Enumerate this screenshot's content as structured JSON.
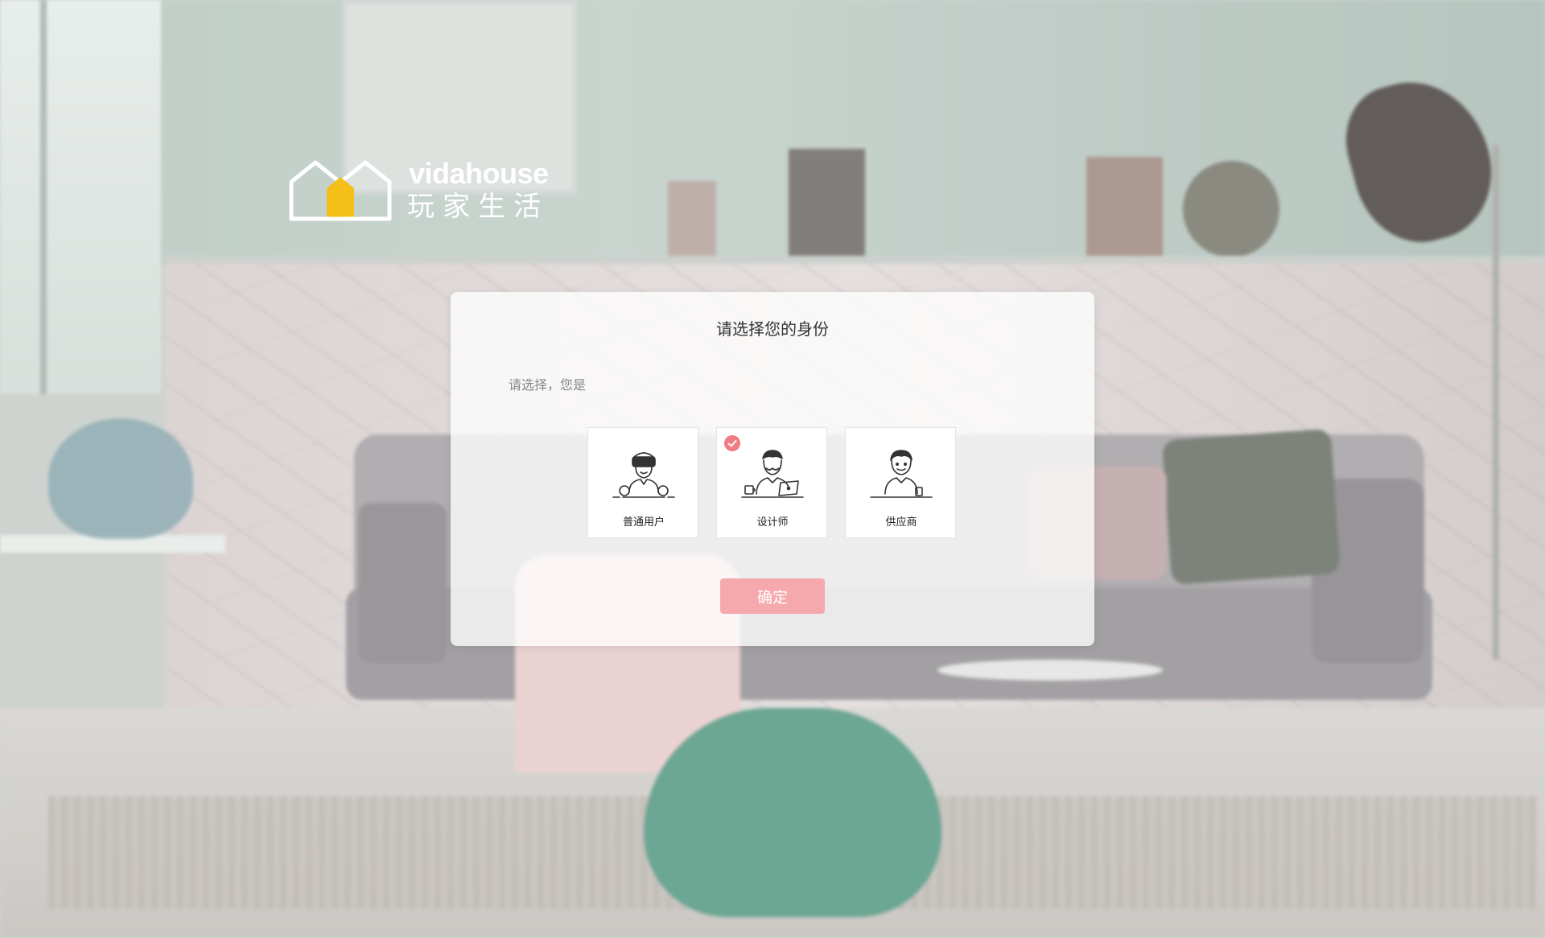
{
  "logo": {
    "wordmark": "vidahouse",
    "cn_name": "玩家生活",
    "accent_color": "#f5bf1a"
  },
  "dialog": {
    "title": "请选择您的身份",
    "prompt": "请选择，您是",
    "options": [
      {
        "label": "普通用户",
        "icon": "user-vr-avatar-icon",
        "selected": false
      },
      {
        "label": "设计师",
        "icon": "designer-laptop-avatar-icon",
        "selected": true
      },
      {
        "label": "供应商",
        "icon": "supplier-avatar-icon",
        "selected": false
      }
    ],
    "confirm_label": "确定",
    "confirm_color": "#f6a9ad",
    "check_color": "#f07c82"
  }
}
